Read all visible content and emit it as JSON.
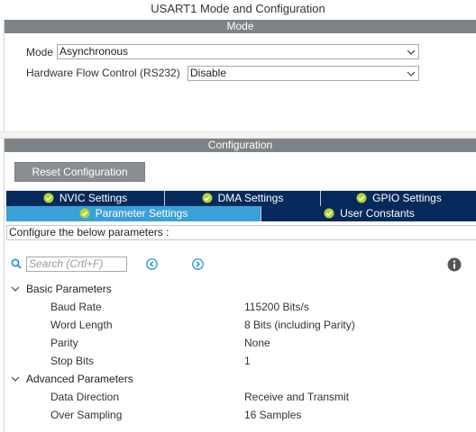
{
  "window": {
    "title": "USART1 Mode and Configuration"
  },
  "mode_section": {
    "header": "Mode",
    "mode_label": "Mode",
    "mode_value": "Asynchronous",
    "flow_label": "Hardware Flow Control (RS232)",
    "flow_value": "Disable"
  },
  "config_section": {
    "header": "Configuration",
    "reset_label": "Reset Configuration",
    "tabs_row1": [
      {
        "label": "NVIC Settings"
      },
      {
        "label": "DMA Settings"
      },
      {
        "label": "GPIO Settings"
      }
    ],
    "tabs_row2": [
      {
        "label": "Parameter Settings",
        "active": true
      },
      {
        "label": "User Constants"
      }
    ],
    "configure_text": "Configure the below parameters :",
    "search_placeholder": "Search (Crtl+F)"
  },
  "parameters": {
    "groups": [
      {
        "name": "Basic Parameters",
        "items": [
          {
            "label": "Baud Rate",
            "value": "115200 Bits/s"
          },
          {
            "label": "Word Length",
            "value": "8 Bits (including Parity)"
          },
          {
            "label": "Parity",
            "value": "None"
          },
          {
            "label": "Stop Bits",
            "value": "1"
          }
        ]
      },
      {
        "name": "Advanced Parameters",
        "items": [
          {
            "label": "Data Direction",
            "value": "Receive and Transmit"
          },
          {
            "label": "Over Sampling",
            "value": "16 Samples"
          }
        ]
      }
    ]
  },
  "colors": {
    "section_bar": "#7e8388",
    "tab_dark": "#04295a",
    "tab_active": "#3aa0d8",
    "check_green": "#b5d334",
    "nav_blue": "#1a8fd6"
  }
}
